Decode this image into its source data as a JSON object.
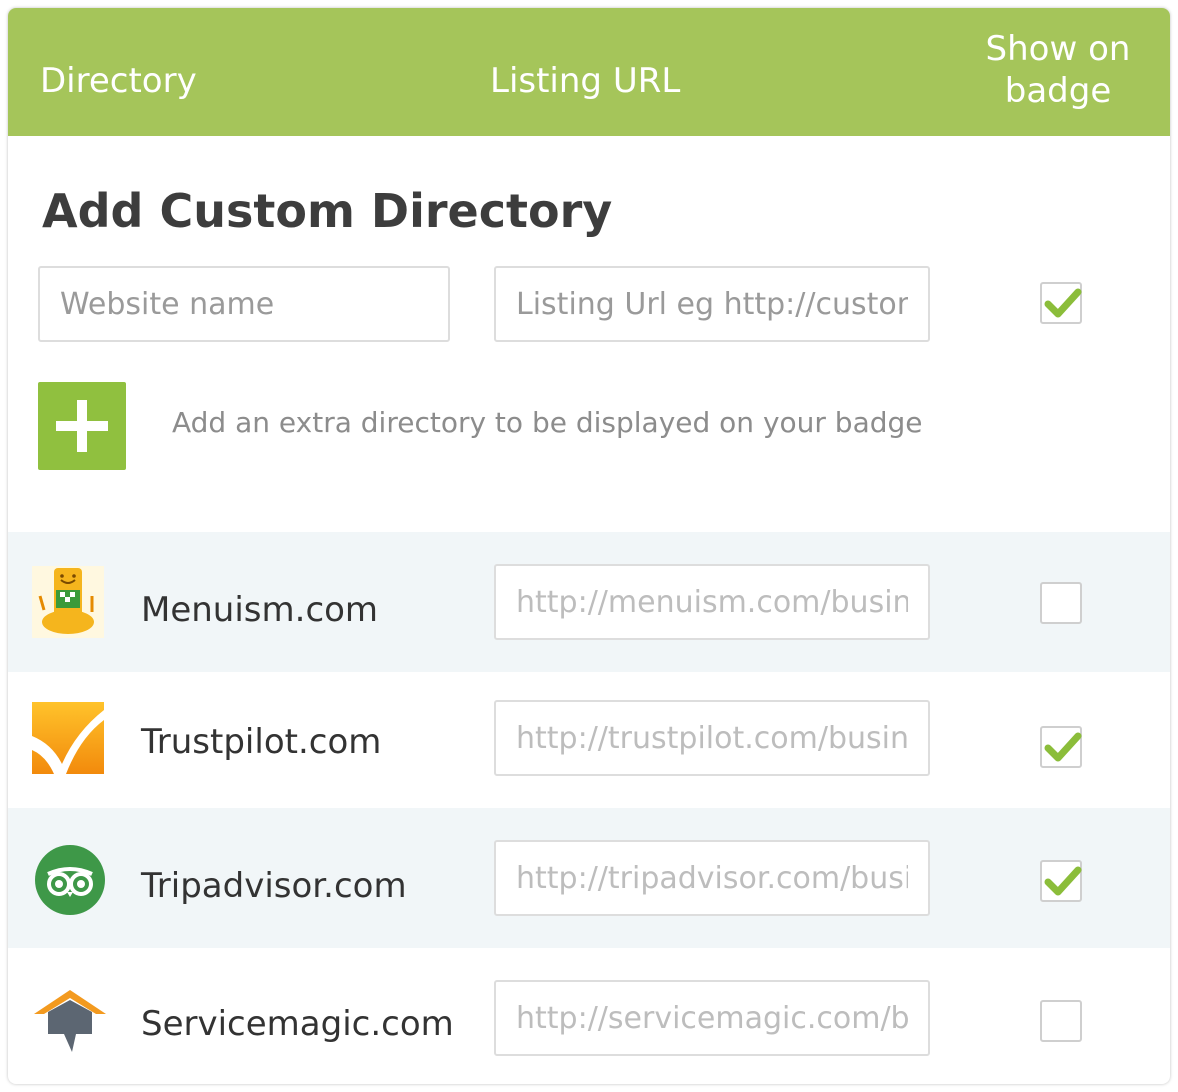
{
  "header": {
    "directory": "Directory",
    "listing_url": "Listing URL",
    "show_on_badge_line1": "Show on",
    "show_on_badge_line2": "badge"
  },
  "custom": {
    "title": "Add Custom Directory",
    "website_placeholder": "Website name",
    "url_placeholder": "Listing Url eg http://customsite.com/yourbusiness",
    "show_checked": true,
    "add_hint": "Add an extra directory to be displayed on your badge"
  },
  "directories": [
    {
      "name": "Menuism.com",
      "url": "http://menuism.com/business",
      "logo": "menuism-logo",
      "checked": false
    },
    {
      "name": "Trustpilot.com",
      "url": "http://trustpilot.com/business",
      "logo": "trustpilot-logo",
      "checked": true
    },
    {
      "name": "Tripadvisor.com",
      "url": "http://tripadvisor.com/business",
      "logo": "tripadvisor-owl-logo",
      "checked": true
    },
    {
      "name": "Servicemagic.com",
      "url": "http://servicemagic.com/business",
      "logo": "servicemagic-logo",
      "checked": false
    }
  ],
  "colors": {
    "header": "#a5c55a",
    "add_button": "#90c03f",
    "check": "#8bbd3a",
    "alt_row": "#f1f6f8",
    "tripadvisor": "#3e9848",
    "trustpilot": "#f6a21b"
  }
}
